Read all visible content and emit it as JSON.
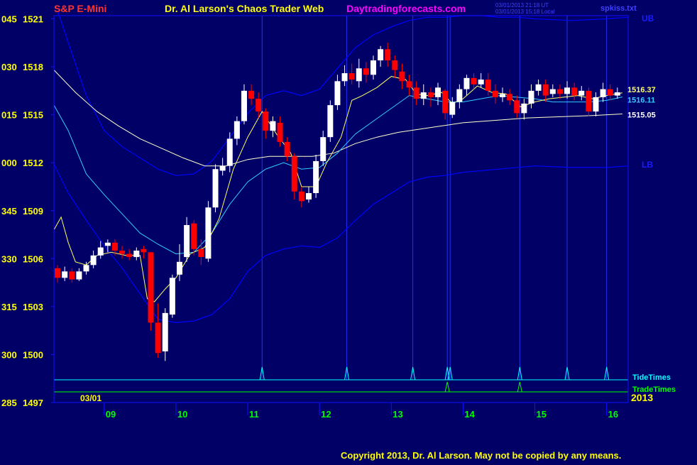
{
  "header": {
    "instrument": "S&P E-Mini",
    "title": "Dr. Al Larson's Chaos Trader Web",
    "site": "Daytradingforecasts.com",
    "utc_stamp": "03/01/2013 21:18 UT",
    "local_stamp": "03/01/2013 15:18 Local",
    "filename": "spkiss.txt"
  },
  "footer": {
    "copyright": "Copyright 2013, Dr. Al Larson. May not be copied by any means."
  },
  "colors": {
    "background": "#000066",
    "frame": "#1010ff",
    "up_bar": "#ffffff",
    "down_bar": "#ff0000",
    "mav_fast": "#ffff66",
    "mav_mid": "#33ccff",
    "mav_slow": "#ffffcc",
    "bands": "#0000ff",
    "tide": "#00ffff",
    "trade": "#00ff00",
    "price_axis": "#ffff00",
    "time_axis": "#00ff00",
    "title": "#ffff00",
    "instrument": "#ff3333",
    "site": "#ff00ff"
  },
  "chart_data": {
    "type": "candlestick",
    "date_label": "03/01",
    "year_label": "2013",
    "xlim": [
      8.3,
      16.3
    ],
    "ylim": [
      1497,
      1521.2
    ],
    "y_ticks": [
      {
        "v": 1521,
        "a": "045",
        "b": "1521"
      },
      {
        "v": 1518,
        "a": "030",
        "b": "1518"
      },
      {
        "v": 1515,
        "a": "015",
        "b": "1515"
      },
      {
        "v": 1512,
        "a": "000",
        "b": "1512"
      },
      {
        "v": 1509,
        "a": "345",
        "b": "1509"
      },
      {
        "v": 1506,
        "a": "330",
        "b": "1506"
      },
      {
        "v": 1503,
        "a": "315",
        "b": "1503"
      },
      {
        "v": 1500,
        "a": "300",
        "b": "1500"
      },
      {
        "v": 1497,
        "a": "285",
        "b": "1497"
      }
    ],
    "x_ticks": [
      "09",
      "10",
      "11",
      "12",
      "13",
      "14",
      "15",
      "16"
    ],
    "band_labels": {
      "upper": "UB",
      "lower": "LB"
    },
    "price_labels": [
      {
        "text": "1516.37",
        "value": 1516.37,
        "color": "#ffff66"
      },
      {
        "text": "1516.11",
        "value": 1516.11,
        "color": "#33ccff"
      },
      {
        "text": "1515.05",
        "value": 1515.05,
        "color": "#ffffff"
      }
    ],
    "rows": {
      "tide": "TideTimes",
      "trade": "TradeTimes"
    },
    "tide_times": [
      11.2,
      12.38,
      13.3,
      13.78,
      13.82,
      14.79,
      15.45,
      16.0
    ],
    "trade_times": [
      13.78,
      14.79
    ],
    "mav_fast": [
      [
        8.3,
        1507.8
      ],
      [
        8.4,
        1508.6
      ],
      [
        8.5,
        1507
      ],
      [
        8.6,
        1505.8
      ],
      [
        8.75,
        1505.6
      ],
      [
        8.9,
        1506.2
      ],
      [
        9.1,
        1506.4
      ],
      [
        9.3,
        1506.2
      ],
      [
        9.5,
        1506.2
      ],
      [
        9.6,
        1503.5
      ],
      [
        9.7,
        1503.3
      ],
      [
        9.85,
        1504.1
      ],
      [
        10.0,
        1504.8
      ],
      [
        10.2,
        1506.3
      ],
      [
        10.4,
        1506.7
      ],
      [
        10.6,
        1508.5
      ],
      [
        10.8,
        1511.6
      ],
      [
        11.0,
        1513.6
      ],
      [
        11.2,
        1515.2
      ],
      [
        11.4,
        1513.8
      ],
      [
        11.6,
        1512.6
      ],
      [
        11.75,
        1510.5
      ],
      [
        11.95,
        1510.5
      ],
      [
        12.1,
        1512
      ],
      [
        12.3,
        1513.6
      ],
      [
        12.45,
        1515.9
      ],
      [
        12.6,
        1516.2
      ],
      [
        12.8,
        1516.7
      ],
      [
        13.0,
        1517.4
      ],
      [
        13.2,
        1517.2
      ],
      [
        13.35,
        1516.3
      ],
      [
        13.5,
        1516.2
      ],
      [
        13.7,
        1516.4
      ],
      [
        13.85,
        1515.7
      ],
      [
        14.0,
        1516
      ],
      [
        14.2,
        1516.8
      ],
      [
        14.4,
        1516.4
      ],
      [
        14.6,
        1516.3
      ],
      [
        14.8,
        1515.5
      ],
      [
        15.0,
        1515.8
      ],
      [
        15.2,
        1516
      ],
      [
        15.4,
        1516.1
      ],
      [
        15.6,
        1516.2
      ],
      [
        15.8,
        1516
      ],
      [
        16.0,
        1516.2
      ],
      [
        16.22,
        1516.37
      ]
    ],
    "mav_mid": [
      [
        8.3,
        1515.6
      ],
      [
        8.5,
        1514
      ],
      [
        8.75,
        1511.3
      ],
      [
        9.0,
        1510
      ],
      [
        9.25,
        1508.8
      ],
      [
        9.5,
        1507.6
      ],
      [
        9.75,
        1506.9
      ],
      [
        10.0,
        1506.3
      ],
      [
        10.25,
        1506.4
      ],
      [
        10.5,
        1507.6
      ],
      [
        10.75,
        1509.4
      ],
      [
        11.0,
        1510.8
      ],
      [
        11.25,
        1511.6
      ],
      [
        11.5,
        1512
      ],
      [
        11.75,
        1511.6
      ],
      [
        12.0,
        1511.7
      ],
      [
        12.25,
        1512.6
      ],
      [
        12.5,
        1513.8
      ],
      [
        12.75,
        1514.6
      ],
      [
        13.0,
        1515.4
      ],
      [
        13.25,
        1516.2
      ],
      [
        13.5,
        1516
      ],
      [
        13.75,
        1515.8
      ],
      [
        14.0,
        1515.8
      ],
      [
        14.25,
        1516
      ],
      [
        14.5,
        1516.2
      ],
      [
        14.75,
        1516.1
      ],
      [
        15.0,
        1516
      ],
      [
        15.25,
        1515.8
      ],
      [
        15.5,
        1515.8
      ],
      [
        15.75,
        1515.8
      ],
      [
        16.0,
        1515.9
      ],
      [
        16.22,
        1516.11
      ]
    ],
    "mav_slow": [
      [
        8.3,
        1517.8
      ],
      [
        8.6,
        1516.4
      ],
      [
        8.9,
        1515.2
      ],
      [
        9.2,
        1514.3
      ],
      [
        9.5,
        1513.5
      ],
      [
        9.8,
        1512.9
      ],
      [
        10.1,
        1512.3
      ],
      [
        10.4,
        1511.8
      ],
      [
        10.7,
        1511.8
      ],
      [
        11.0,
        1512.2
      ],
      [
        11.3,
        1512.4
      ],
      [
        11.6,
        1512.4
      ],
      [
        11.9,
        1512.4
      ],
      [
        12.2,
        1512.6
      ],
      [
        12.5,
        1513.2
      ],
      [
        12.8,
        1513.6
      ],
      [
        13.1,
        1513.9
      ],
      [
        13.4,
        1514.1
      ],
      [
        13.7,
        1514.3
      ],
      [
        14.0,
        1514.5
      ],
      [
        14.3,
        1514.6
      ],
      [
        14.6,
        1514.7
      ],
      [
        14.9,
        1514.8
      ],
      [
        15.2,
        1514.85
      ],
      [
        15.5,
        1514.9
      ],
      [
        15.8,
        1514.95
      ],
      [
        16.22,
        1515.05
      ]
    ],
    "upper_band": [
      [
        8.35,
        1521.5
      ],
      [
        8.5,
        1519.5
      ],
      [
        8.75,
        1516.2
      ],
      [
        9.0,
        1514
      ],
      [
        9.25,
        1513
      ],
      [
        9.5,
        1512.3
      ],
      [
        9.75,
        1511.6
      ],
      [
        10.0,
        1511.2
      ],
      [
        10.25,
        1511.3
      ],
      [
        10.5,
        1512.1
      ],
      [
        10.75,
        1513.6
      ],
      [
        11.0,
        1515.1
      ],
      [
        11.25,
        1516.2
      ],
      [
        11.5,
        1516.5
      ],
      [
        11.75,
        1516.2
      ],
      [
        12.0,
        1516.6
      ],
      [
        12.25,
        1517.9
      ],
      [
        12.5,
        1519.2
      ],
      [
        12.75,
        1520
      ],
      [
        13.0,
        1520.5
      ],
      [
        13.25,
        1520.9
      ],
      [
        13.5,
        1521.1
      ],
      [
        13.75,
        1521.1
      ],
      [
        14.0,
        1521.2
      ],
      [
        14.25,
        1521.2
      ],
      [
        14.5,
        1521.1
      ],
      [
        14.75,
        1521.1
      ],
      [
        15.0,
        1521
      ],
      [
        15.5,
        1520.9
      ],
      [
        16.0,
        1521
      ],
      [
        16.3,
        1521.1
      ]
    ],
    "lower_band": [
      [
        8.3,
        1511.9
      ],
      [
        8.5,
        1510.1
      ],
      [
        8.75,
        1508.4
      ],
      [
        9.0,
        1506.8
      ],
      [
        9.25,
        1505.4
      ],
      [
        9.5,
        1503.8
      ],
      [
        9.75,
        1502.2
      ],
      [
        10.0,
        1502
      ],
      [
        10.25,
        1502.1
      ],
      [
        10.5,
        1502.5
      ],
      [
        10.75,
        1503.5
      ],
      [
        11.0,
        1505.2
      ],
      [
        11.25,
        1506.2
      ],
      [
        11.5,
        1506.6
      ],
      [
        11.75,
        1506.8
      ],
      [
        12.0,
        1506.7
      ],
      [
        12.25,
        1507.3
      ],
      [
        12.5,
        1508.4
      ],
      [
        12.75,
        1509.4
      ],
      [
        13.0,
        1510.1
      ],
      [
        13.25,
        1510.8
      ],
      [
        13.5,
        1511.1
      ],
      [
        13.75,
        1511.2
      ],
      [
        14.0,
        1511.4
      ],
      [
        14.5,
        1511.6
      ],
      [
        15.0,
        1511.8
      ],
      [
        15.5,
        1511.7
      ],
      [
        16.0,
        1511.7
      ],
      [
        16.3,
        1511.8
      ]
    ],
    "candles": [
      [
        8.35,
        1505.4,
        1504.8,
        1505.6,
        1504.5
      ],
      [
        8.45,
        1504.8,
        1505.2,
        1505.5,
        1504.6
      ],
      [
        8.55,
        1505.2,
        1504.7,
        1505.4,
        1504.5
      ],
      [
        8.65,
        1504.7,
        1505.2,
        1505.4,
        1504.6
      ],
      [
        8.75,
        1505.2,
        1505.6,
        1505.8,
        1505
      ],
      [
        8.85,
        1505.6,
        1506.2,
        1506.5,
        1505.4
      ],
      [
        8.95,
        1506.2,
        1506.7,
        1507.1,
        1506
      ],
      [
        9.05,
        1506.8,
        1507,
        1507.2,
        1506.4
      ],
      [
        9.15,
        1507,
        1506.5,
        1507.2,
        1506.2
      ],
      [
        9.25,
        1506.5,
        1506.3,
        1506.8,
        1506
      ],
      [
        9.35,
        1506.3,
        1506.1,
        1506.6,
        1505.9
      ],
      [
        9.45,
        1506.1,
        1506.5,
        1506.7,
        1505.9
      ],
      [
        9.55,
        1506.6,
        1506.4,
        1506.8,
        1506
      ],
      [
        9.65,
        1506.4,
        1502,
        1506.4,
        1501.5
      ],
      [
        9.75,
        1502,
        1500.1,
        1503.2,
        1499.8
      ],
      [
        9.85,
        1500.2,
        1502.6,
        1502.9,
        1499.6
      ],
      [
        9.95,
        1502.5,
        1504.8,
        1505,
        1502.3
      ],
      [
        10.05,
        1505,
        1505.8,
        1506.9,
        1504.6
      ],
      [
        10.15,
        1506.1,
        1508.1,
        1508.6,
        1505.8
      ],
      [
        10.25,
        1508.2,
        1506.6,
        1508.4,
        1506.2
      ],
      [
        10.35,
        1506.6,
        1506.1,
        1507.2,
        1505.6
      ],
      [
        10.45,
        1506,
        1509.2,
        1509.6,
        1505.8
      ],
      [
        10.55,
        1509.2,
        1511.6,
        1511.9,
        1508.9
      ],
      [
        10.65,
        1511.5,
        1511.8,
        1512.3,
        1511.2
      ],
      [
        10.75,
        1511.8,
        1513.5,
        1513.9,
        1511.4
      ],
      [
        10.85,
        1513.5,
        1514.6,
        1514.9,
        1513.1
      ],
      [
        10.95,
        1514.6,
        1516.5,
        1516.9,
        1514.4
      ],
      [
        11.05,
        1516.5,
        1516,
        1516.9,
        1515.6
      ],
      [
        11.15,
        1516,
        1515.2,
        1516.4,
        1514.8
      ],
      [
        11.25,
        1515.2,
        1514,
        1515.4,
        1513.5
      ],
      [
        11.35,
        1514,
        1514.6,
        1514.9,
        1513.6
      ],
      [
        11.45,
        1514.5,
        1513.3,
        1514.9,
        1513
      ],
      [
        11.55,
        1513.3,
        1512.4,
        1513.6,
        1512.1
      ],
      [
        11.65,
        1512.4,
        1510.2,
        1512.6,
        1509.7
      ],
      [
        11.75,
        1510.2,
        1509.6,
        1510.5,
        1509.2
      ],
      [
        11.85,
        1509.7,
        1510.1,
        1510.5,
        1509.5
      ],
      [
        11.95,
        1510.1,
        1512.1,
        1512.5,
        1509.8
      ],
      [
        12.05,
        1512.1,
        1513.6,
        1514,
        1511.8
      ],
      [
        12.15,
        1513.6,
        1515.6,
        1515.9,
        1513.3
      ],
      [
        12.25,
        1515.6,
        1517.1,
        1517.5,
        1515.3
      ],
      [
        12.35,
        1517.1,
        1517.6,
        1518.1,
        1516.8
      ],
      [
        12.45,
        1517.6,
        1517.2,
        1518.2,
        1516.9
      ],
      [
        12.55,
        1517.1,
        1517.9,
        1518.5,
        1516.7
      ],
      [
        12.65,
        1517.9,
        1517.5,
        1518.3,
        1517
      ],
      [
        12.75,
        1517.5,
        1518.4,
        1518.7,
        1517.2
      ],
      [
        12.85,
        1518.4,
        1519.1,
        1519.3,
        1518
      ],
      [
        12.95,
        1519.1,
        1518.4,
        1519.5,
        1518
      ],
      [
        13.05,
        1518.4,
        1517.8,
        1518.7,
        1517.3
      ],
      [
        13.15,
        1517.7,
        1517.1,
        1518.2,
        1516.6
      ],
      [
        13.25,
        1517.1,
        1516.7,
        1517.5,
        1516.2
      ],
      [
        13.35,
        1516.7,
        1516,
        1517.1,
        1515.6
      ],
      [
        13.45,
        1516,
        1516.4,
        1516.9,
        1515.6
      ],
      [
        13.55,
        1516.4,
        1516.1,
        1516.7,
        1515.5
      ],
      [
        13.65,
        1516.1,
        1516.7,
        1517,
        1515.6
      ],
      [
        13.75,
        1516.5,
        1515.1,
        1516.6,
        1514.7
      ],
      [
        13.85,
        1515,
        1515.8,
        1516.1,
        1514.8
      ],
      [
        13.95,
        1515.8,
        1516.6,
        1516.9,
        1515.4
      ],
      [
        14.05,
        1516.6,
        1517.3,
        1517.5,
        1516.2
      ],
      [
        14.15,
        1517.3,
        1516.9,
        1517.6,
        1516.6
      ],
      [
        14.25,
        1516.9,
        1517.2,
        1517.6,
        1516.7
      ],
      [
        14.35,
        1517.2,
        1516.5,
        1517.6,
        1516.2
      ],
      [
        14.45,
        1516.5,
        1516.1,
        1516.9,
        1515.7
      ],
      [
        14.55,
        1516.1,
        1516.3,
        1516.7,
        1515.8
      ],
      [
        14.65,
        1516.3,
        1515.9,
        1516.6,
        1515.6
      ],
      [
        14.75,
        1515.9,
        1515.1,
        1516.2,
        1514.8
      ],
      [
        14.85,
        1515.1,
        1515.7,
        1516,
        1514.7
      ],
      [
        14.95,
        1515.7,
        1516.5,
        1516.9,
        1515.4
      ],
      [
        15.05,
        1516.5,
        1516.9,
        1517.2,
        1516.2
      ],
      [
        15.15,
        1516.9,
        1516.2,
        1517.2,
        1515.8
      ],
      [
        15.25,
        1516.3,
        1516.6,
        1516.9,
        1516.1
      ],
      [
        15.35,
        1516.6,
        1516.3,
        1516.9,
        1516
      ],
      [
        15.45,
        1516.3,
        1516.7,
        1517.1,
        1516
      ],
      [
        15.55,
        1516.7,
        1516.2,
        1517,
        1515.9
      ],
      [
        15.65,
        1516.2,
        1516.5,
        1516.8,
        1515.9
      ],
      [
        15.75,
        1516.5,
        1515.2,
        1516.7,
        1514.9
      ],
      [
        15.85,
        1515.2,
        1516.1,
        1516.4,
        1514.9
      ],
      [
        15.95,
        1516.1,
        1516.6,
        1517,
        1515.8
      ],
      [
        16.05,
        1516.6,
        1516.2,
        1516.9,
        1515.9
      ],
      [
        16.15,
        1516.2,
        1516.4,
        1516.7,
        1516
      ]
    ]
  }
}
